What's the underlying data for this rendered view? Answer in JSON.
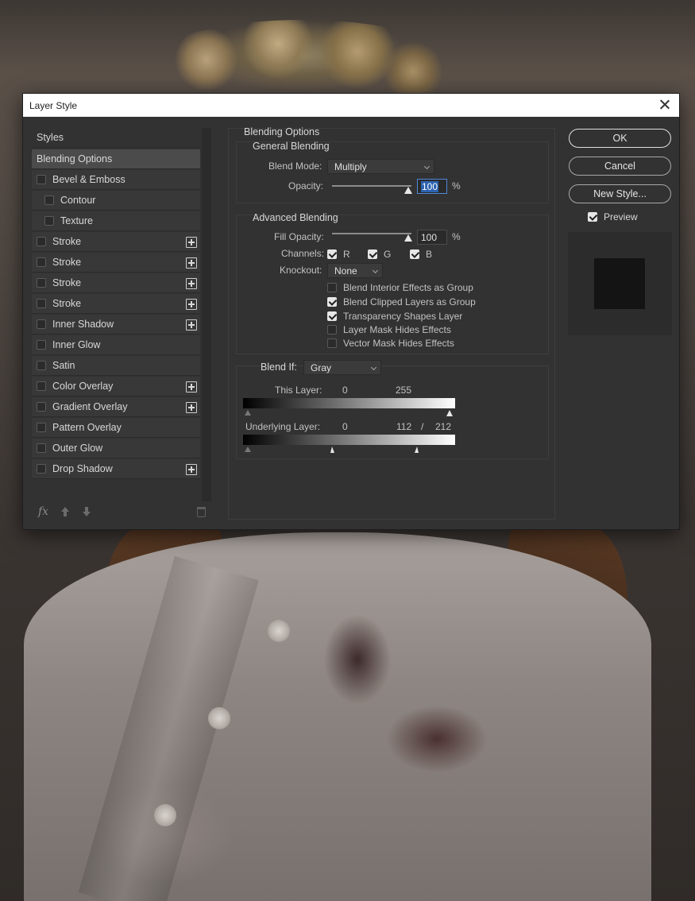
{
  "dialog": {
    "title": "Layer Style"
  },
  "style_list": {
    "header": "Styles",
    "items": [
      {
        "label": "Blending Options",
        "selected": true,
        "checkbox": false,
        "plus": false
      },
      {
        "label": "Bevel & Emboss",
        "checkbox": true,
        "plus": false
      },
      {
        "label": "Contour",
        "checkbox": true,
        "plus": false,
        "indent": true
      },
      {
        "label": "Texture",
        "checkbox": true,
        "plus": false,
        "indent": true
      },
      {
        "label": "Stroke",
        "checkbox": true,
        "plus": true
      },
      {
        "label": "Stroke",
        "checkbox": true,
        "plus": true
      },
      {
        "label": "Stroke",
        "checkbox": true,
        "plus": true
      },
      {
        "label": "Stroke",
        "checkbox": true,
        "plus": true
      },
      {
        "label": "Inner Shadow",
        "checkbox": true,
        "plus": true
      },
      {
        "label": "Inner Glow",
        "checkbox": true,
        "plus": false
      },
      {
        "label": "Satin",
        "checkbox": true,
        "plus": false
      },
      {
        "label": "Color Overlay",
        "checkbox": true,
        "plus": true
      },
      {
        "label": "Gradient Overlay",
        "checkbox": true,
        "plus": true
      },
      {
        "label": "Pattern Overlay",
        "checkbox": true,
        "plus": false
      },
      {
        "label": "Outer Glow",
        "checkbox": true,
        "plus": false
      },
      {
        "label": "Drop Shadow",
        "checkbox": true,
        "plus": true
      }
    ],
    "footer": {
      "fx_label": "fx"
    }
  },
  "blending_options": {
    "section_title": "Blending Options",
    "general": {
      "title": "General Blending",
      "blend_mode_label": "Blend Mode:",
      "blend_mode_value": "Multiply",
      "opacity_label": "Opacity:",
      "opacity_value": "100",
      "opacity_unit": "%",
      "opacity_fraction": 1.0
    },
    "advanced": {
      "title": "Advanced Blending",
      "fill_opacity_label": "Fill Opacity:",
      "fill_opacity_value": "100",
      "fill_opacity_unit": "%",
      "fill_opacity_fraction": 1.0,
      "channels_label": "Channels:",
      "channels": [
        {
          "label": "R",
          "checked": true
        },
        {
          "label": "G",
          "checked": true
        },
        {
          "label": "B",
          "checked": true
        }
      ],
      "knockout_label": "Knockout:",
      "knockout_value": "None",
      "options": [
        {
          "label": "Blend Interior Effects as Group",
          "checked": false
        },
        {
          "label": "Blend Clipped Layers as Group",
          "checked": true
        },
        {
          "label": "Transparency Shapes Layer",
          "checked": true
        },
        {
          "label": "Layer Mask Hides Effects",
          "checked": false
        },
        {
          "label": "Vector Mask Hides Effects",
          "checked": false
        }
      ]
    },
    "blend_if": {
      "label": "Blend If:",
      "value": "Gray",
      "this_layer_label": "This Layer:",
      "this_layer_min": "0",
      "this_layer_max": "255",
      "underlying_label": "Underlying Layer:",
      "underlying_min": "0",
      "underlying_split_low": "112",
      "underlying_separator": "/",
      "underlying_split_high": "212"
    }
  },
  "buttons": {
    "ok": "OK",
    "cancel": "Cancel",
    "new_style": "New Style...",
    "preview_label": "Preview",
    "preview_checked": true
  },
  "colors": {
    "dialog_bg": "#323232",
    "selected_item": "#4b4b4b",
    "focus_blue": "#2d63b0"
  }
}
